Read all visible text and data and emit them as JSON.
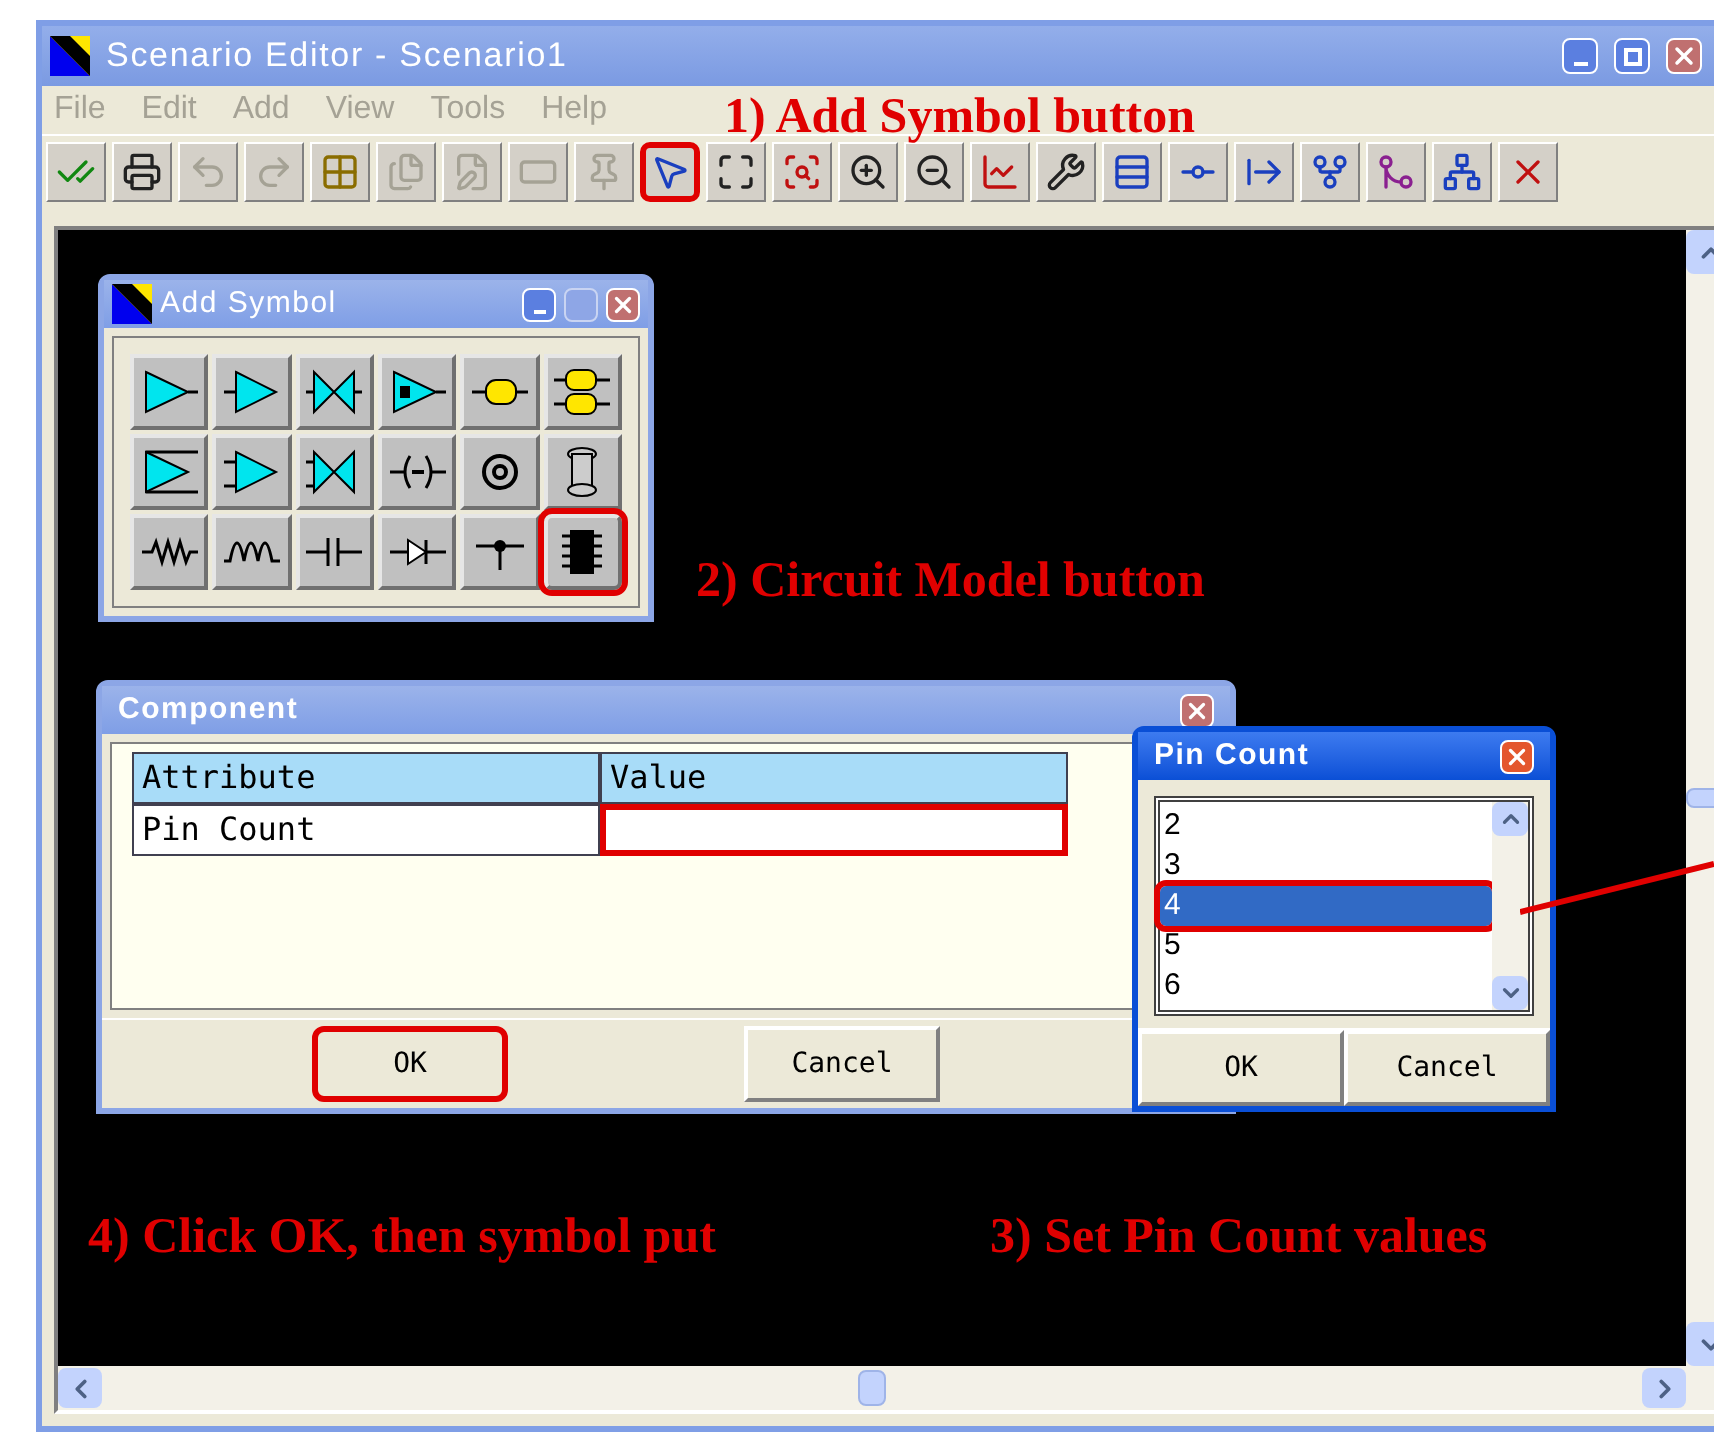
{
  "window": {
    "title": "Scenario Editor - Scenario1"
  },
  "menu": [
    {
      "label": "File",
      "disabled": true
    },
    {
      "label": "Edit",
      "disabled": true
    },
    {
      "label": "Add",
      "disabled": true
    },
    {
      "label": "View",
      "disabled": true
    },
    {
      "label": "Tools",
      "disabled": true
    },
    {
      "label": "Help",
      "disabled": true
    }
  ],
  "toolbar": [
    {
      "kind": "check",
      "disabled": false,
      "highlighted": false
    },
    {
      "kind": "print",
      "disabled": false,
      "highlighted": false
    },
    {
      "kind": "undo",
      "disabled": true,
      "highlighted": false
    },
    {
      "kind": "redo",
      "disabled": true,
      "highlighted": false
    },
    {
      "kind": "grid",
      "disabled": false,
      "highlighted": false
    },
    {
      "kind": "doc",
      "disabled": true,
      "highlighted": false
    },
    {
      "kind": "edit",
      "disabled": true,
      "highlighted": false
    },
    {
      "kind": "bar",
      "disabled": true,
      "highlighted": false
    },
    {
      "kind": "pin",
      "disabled": true,
      "highlighted": false
    },
    {
      "kind": "pointer",
      "disabled": false,
      "highlighted": true
    },
    {
      "kind": "fit",
      "disabled": false,
      "highlighted": false
    },
    {
      "kind": "zoom-area",
      "disabled": false,
      "highlighted": false
    },
    {
      "kind": "zoom-in",
      "disabled": false,
      "highlighted": false
    },
    {
      "kind": "zoom-out",
      "disabled": false,
      "highlighted": false
    },
    {
      "kind": "graph",
      "disabled": false,
      "highlighted": false
    },
    {
      "kind": "probe",
      "disabled": false,
      "highlighted": false
    },
    {
      "kind": "bus",
      "disabled": false,
      "highlighted": false
    },
    {
      "kind": "tee",
      "disabled": false,
      "highlighted": false
    },
    {
      "kind": "tap",
      "disabled": false,
      "highlighted": false
    },
    {
      "kind": "split",
      "disabled": false,
      "highlighted": false
    },
    {
      "kind": "join",
      "disabled": false,
      "highlighted": false
    },
    {
      "kind": "fork",
      "disabled": false,
      "highlighted": false
    },
    {
      "kind": "delete",
      "disabled": false,
      "highlighted": false
    }
  ],
  "add_symbol": {
    "title": "Add Symbol",
    "symbols": [
      {
        "kind": "buffer",
        "highlighted": false
      },
      {
        "kind": "receiver",
        "highlighted": false
      },
      {
        "kind": "bidir",
        "highlighted": false
      },
      {
        "kind": "tristate",
        "highlighted": false
      },
      {
        "kind": "connector",
        "highlighted": false
      },
      {
        "kind": "dual-connector",
        "highlighted": false
      },
      {
        "kind": "diff-buffer",
        "highlighted": false
      },
      {
        "kind": "diff-receiver",
        "highlighted": false
      },
      {
        "kind": "diff-bidir",
        "highlighted": false
      },
      {
        "kind": "coupler",
        "highlighted": false
      },
      {
        "kind": "coax",
        "highlighted": false
      },
      {
        "kind": "spool",
        "highlighted": false
      },
      {
        "kind": "resistor",
        "highlighted": false
      },
      {
        "kind": "inductor",
        "highlighted": false
      },
      {
        "kind": "capacitor",
        "highlighted": false
      },
      {
        "kind": "diode",
        "highlighted": false
      },
      {
        "kind": "node",
        "highlighted": false
      },
      {
        "kind": "chip",
        "highlighted": true
      }
    ]
  },
  "component": {
    "title": "Component",
    "columns": [
      "Attribute",
      "Value"
    ],
    "rows": [
      {
        "attribute": "Pin Count",
        "highlighted": true
      }
    ],
    "buttons": [
      {
        "label": "OK",
        "highlighted": true
      },
      {
        "label": "Cancel",
        "highlighted": false
      }
    ]
  },
  "pin_count": {
    "title": "Pin Count",
    "items": [
      {
        "label": "2",
        "selected": false,
        "highlighted": false
      },
      {
        "label": "3",
        "selected": false,
        "highlighted": false
      },
      {
        "label": "4",
        "selected": true,
        "highlighted": true
      },
      {
        "label": "5",
        "selected": false,
        "highlighted": false
      },
      {
        "label": "6",
        "selected": false,
        "highlighted": false
      }
    ],
    "buttons": [
      "OK",
      "Cancel"
    ]
  },
  "annotations": [
    "1) Add Symbol button",
    "2) Circuit Model button",
    "4) Click OK, then symbol put",
    "3) Set Pin Count values"
  ]
}
